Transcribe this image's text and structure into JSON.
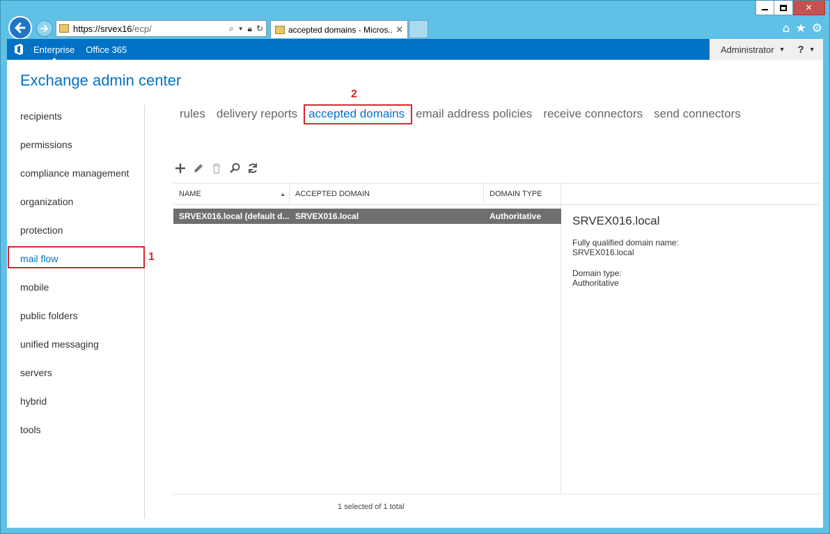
{
  "browser": {
    "url_host": "https://srvex16",
    "url_path": "/ecp/",
    "tab_title": "accepted domains - Micros..."
  },
  "suite_bar": {
    "enterprise": "Enterprise",
    "office365": "Office 365",
    "user": "Administrator",
    "help": "?"
  },
  "app": {
    "title": "Exchange admin center"
  },
  "nav": {
    "items": [
      {
        "label": "recipients"
      },
      {
        "label": "permissions"
      },
      {
        "label": "compliance management"
      },
      {
        "label": "organization"
      },
      {
        "label": "protection"
      },
      {
        "label": "mail flow"
      },
      {
        "label": "mobile"
      },
      {
        "label": "public folders"
      },
      {
        "label": "unified messaging"
      },
      {
        "label": "servers"
      },
      {
        "label": "hybrid"
      },
      {
        "label": "tools"
      }
    ],
    "selected_index": 5
  },
  "subnav": {
    "items": [
      {
        "label": "rules"
      },
      {
        "label": "delivery reports"
      },
      {
        "label": "accepted domains"
      },
      {
        "label": "email address policies"
      },
      {
        "label": "receive connectors"
      },
      {
        "label": "send connectors"
      }
    ],
    "selected_index": 2
  },
  "annotations": {
    "step1": "1",
    "step2": "2"
  },
  "table": {
    "columns": {
      "name": "NAME",
      "accepted_domain": "ACCEPTED DOMAIN",
      "domain_type": "DOMAIN TYPE"
    },
    "rows": [
      {
        "name": "SRVEX016.local (default d...",
        "accepted_domain": "SRVEX016.local",
        "domain_type": "Authoritative"
      }
    ],
    "footer": "1 selected of 1 total"
  },
  "details": {
    "title": "SRVEX016.local",
    "fqdn_label": "Fully qualified domain name:",
    "fqdn_value": "SRVEX016.local",
    "type_label": "Domain type:",
    "type_value": "Authoritative"
  },
  "colors": {
    "accent": "#0072c6",
    "highlight": "#d9252f",
    "selected_row": "#6f6f6f"
  }
}
